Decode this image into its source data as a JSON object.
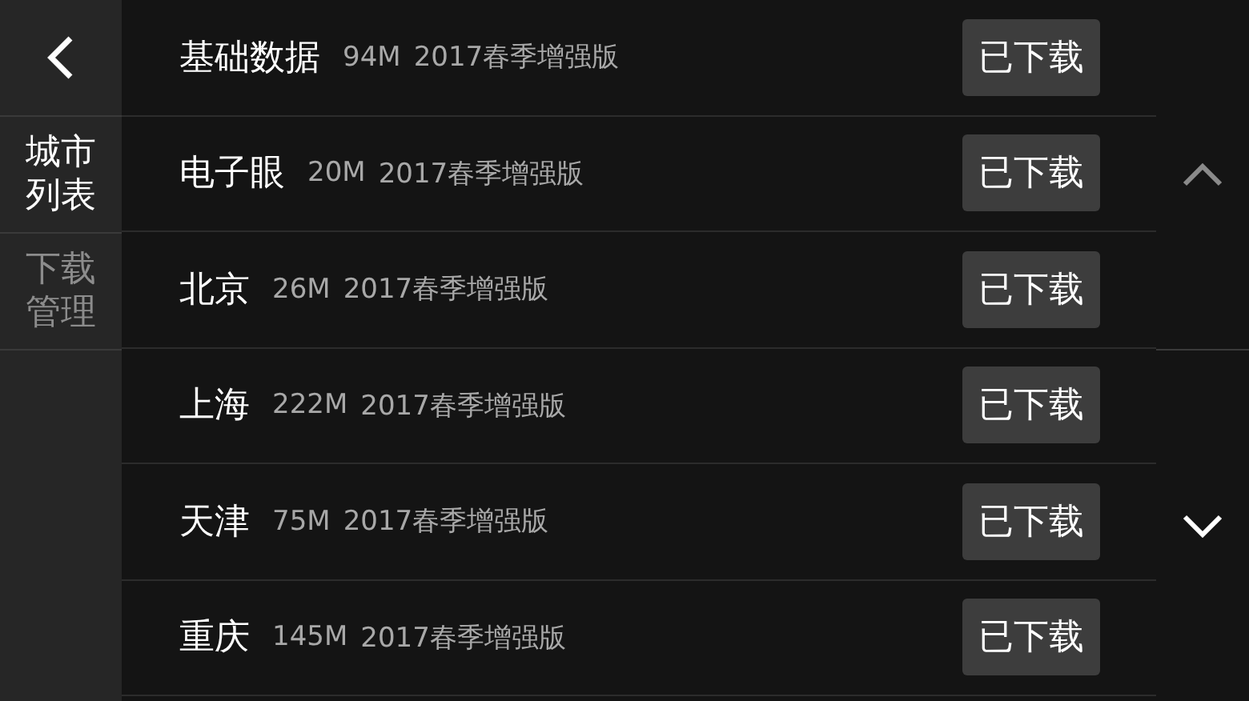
{
  "sidebar": {
    "items": [
      {
        "label": "城市列表",
        "selected": true
      },
      {
        "label": "下载管理",
        "selected": false
      }
    ]
  },
  "rows": [
    {
      "name": "基础数据",
      "size": "94M",
      "version": "2017春季增强版",
      "button": "已下载"
    },
    {
      "name": "电子眼",
      "size": "20M",
      "version": "2017春季增强版",
      "button": "已下载"
    },
    {
      "name": "北京",
      "size": "26M",
      "version": "2017春季增强版",
      "button": "已下载"
    },
    {
      "name": "上海",
      "size": "222M",
      "version": "2017春季增强版",
      "button": "已下载"
    },
    {
      "name": "天津",
      "size": "75M",
      "version": "2017春季增强版",
      "button": "已下载"
    },
    {
      "name": "重庆",
      "size": "145M",
      "version": "2017春季增强版",
      "button": "已下载"
    }
  ],
  "scroll": {
    "up_disabled": true,
    "down_disabled": false
  }
}
